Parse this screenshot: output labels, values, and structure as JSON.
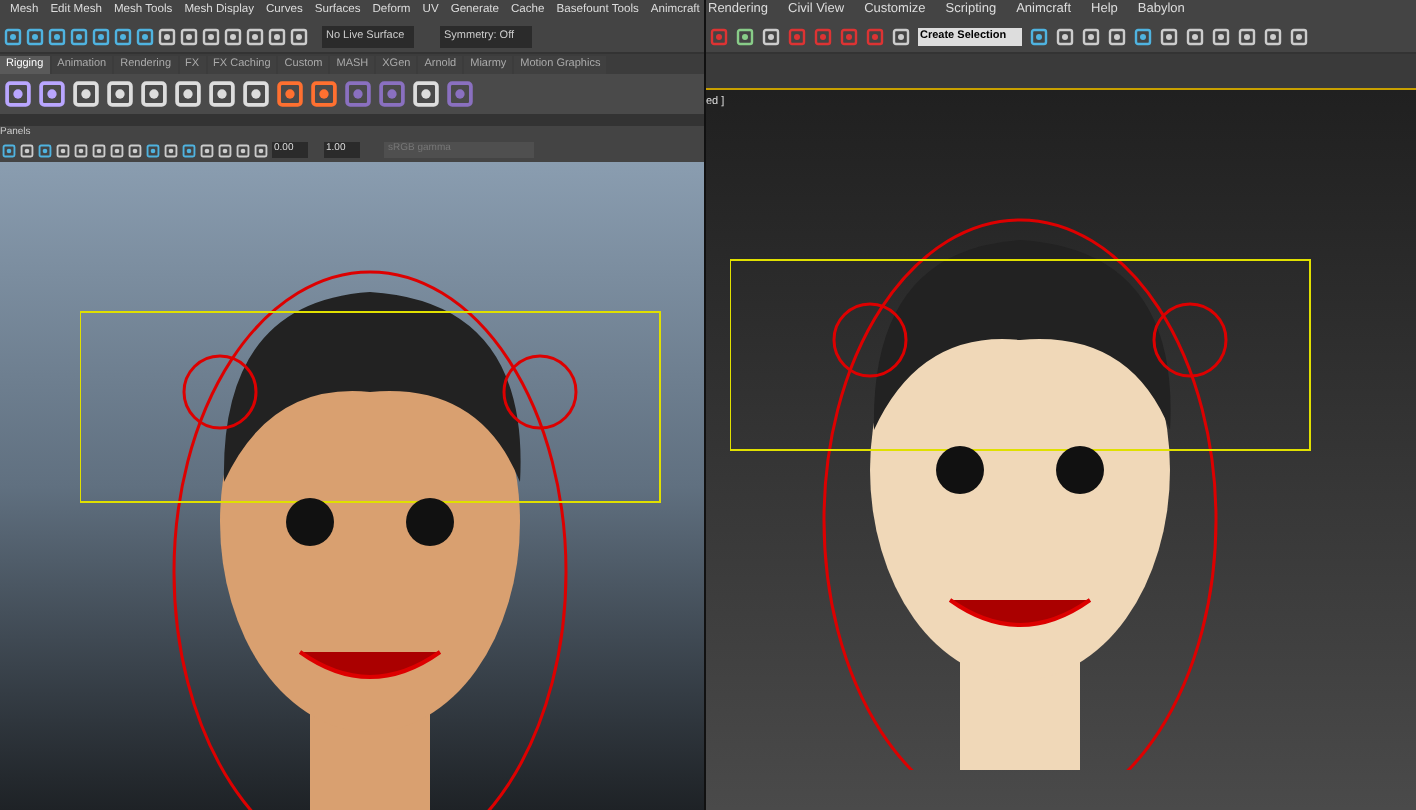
{
  "maya": {
    "menu": [
      "Mesh",
      "Edit Mesh",
      "Mesh Tools",
      "Mesh Display",
      "Curves",
      "Surfaces",
      "Deform",
      "UV",
      "Generate",
      "Cache",
      "Basefount Tools",
      "Animcraft"
    ],
    "live_surface": "No Live Surface",
    "symmetry": "Symmetry: Off",
    "shelf_tabs": [
      {
        "label": "Rigging",
        "selected": true
      },
      {
        "label": "Animation",
        "selected": false
      },
      {
        "label": "Rendering",
        "selected": false
      },
      {
        "label": "FX",
        "selected": false
      },
      {
        "label": "FX Caching",
        "selected": false
      },
      {
        "label": "Custom",
        "selected": false
      },
      {
        "label": "MASH",
        "selected": false
      },
      {
        "label": "XGen",
        "selected": false
      },
      {
        "label": "Arnold",
        "selected": false
      },
      {
        "label": "Miarmy",
        "selected": false
      },
      {
        "label": "Motion Graphics",
        "selected": false
      }
    ],
    "panels_menu": "Panels",
    "exposure": "0.00",
    "gamma": "1.00",
    "color_space": "sRGB gamma"
  },
  "max": {
    "menu": [
      "Rendering",
      "Civil View",
      "Customize",
      "Scripting",
      "Animcraft",
      "Help",
      "Babylon"
    ],
    "selection_set": "Create Selection",
    "viewport_label": "ed ]"
  }
}
